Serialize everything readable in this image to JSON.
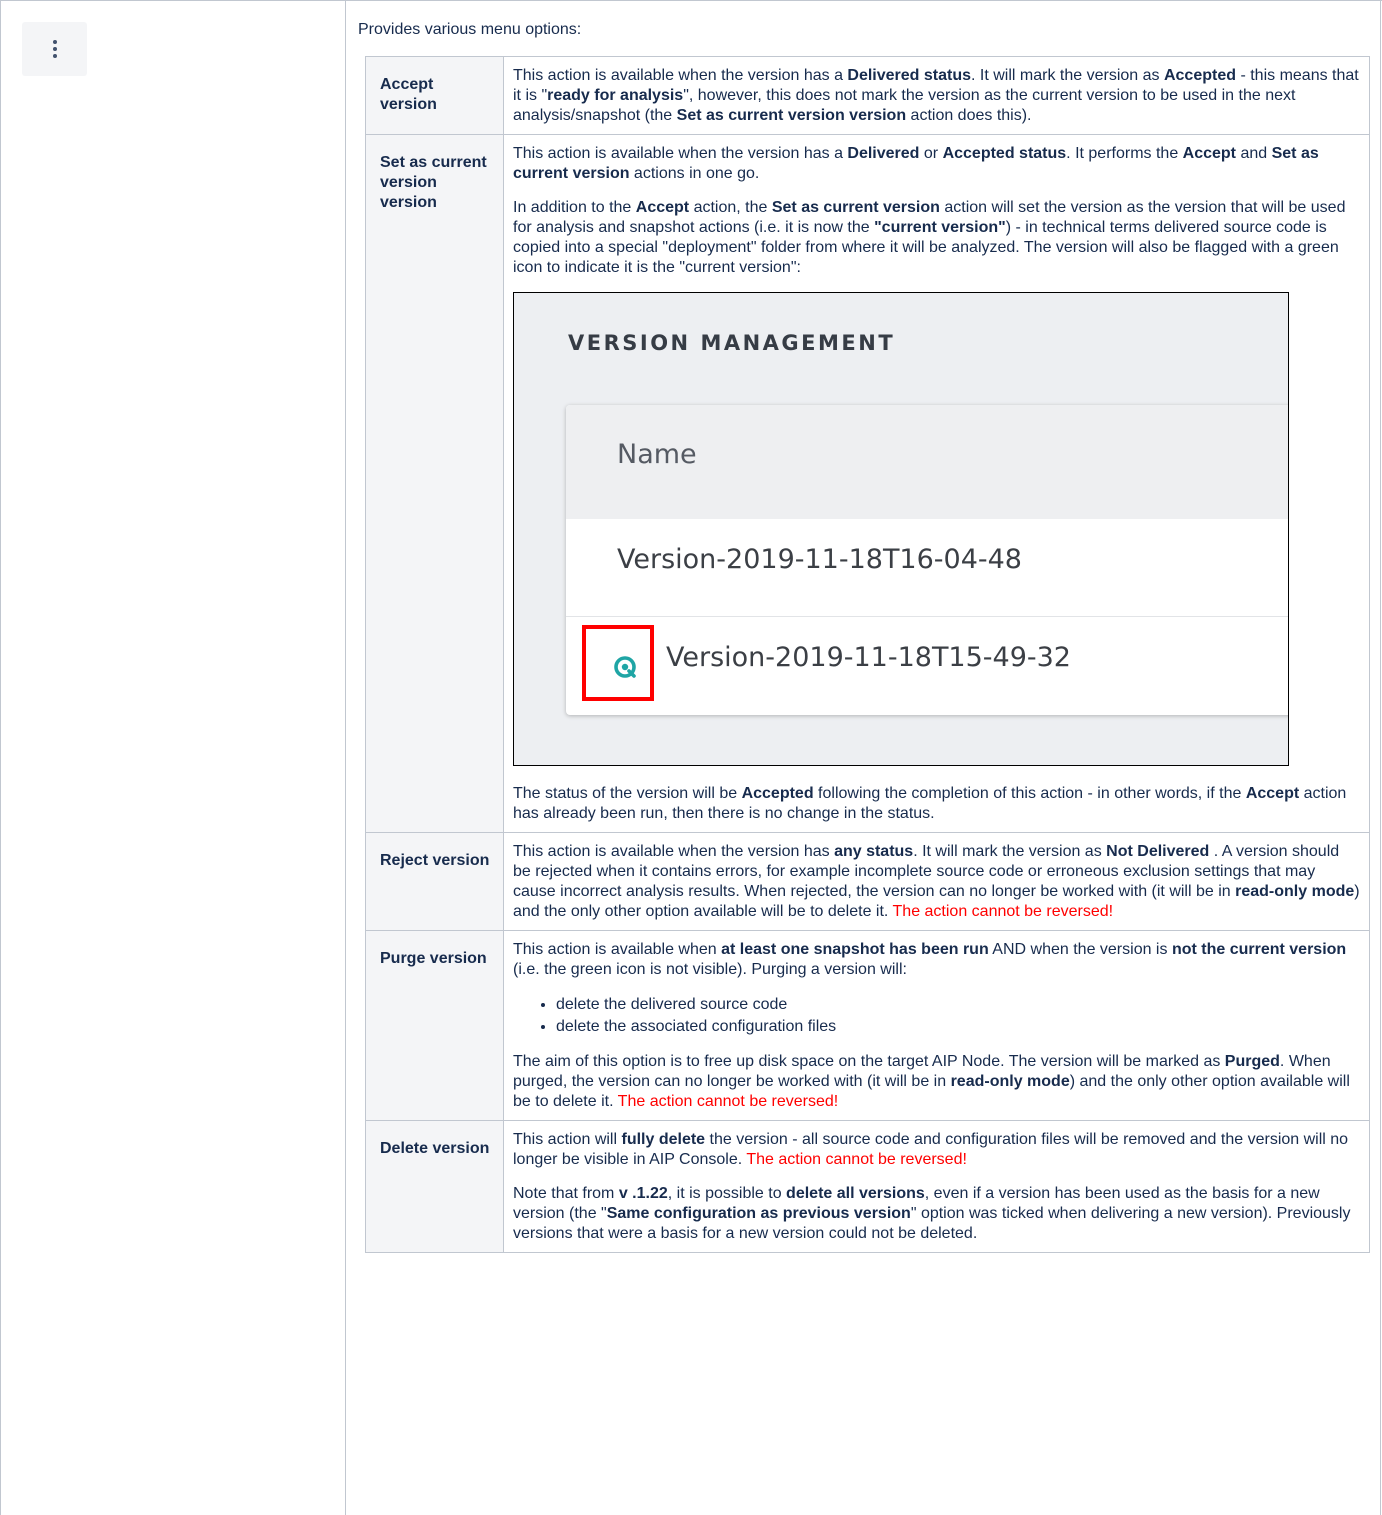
{
  "intro": "Provides various menu options:",
  "rows": {
    "accept": {
      "label": "Accept version",
      "p1": {
        "t1": "This action is available when the version has a ",
        "b1": "Delivered status",
        "t2": ". It will mark the version as ",
        "b2": "Accepted",
        "t3": " - this means that it is \"",
        "b3": "ready for analysis",
        "t4": "\", however, this does not mark the version as the current version to be used in the next analysis/snapshot (the ",
        "b4": "Set as current version version",
        "t5": " action does this)."
      }
    },
    "setcurrent": {
      "label": "Set as current version version",
      "p1": {
        "t1": "This action is available when the version has a ",
        "b1": "Delivered",
        "t2": " or ",
        "b2": "Accepted status",
        "t3": ". It performs the ",
        "b3": "Accept",
        "t4": " and ",
        "b4": "Set as current version",
        "t5": " actions in one go."
      },
      "p2": {
        "t1": "In addition to the ",
        "b1": "Accept",
        "t2": " action, the ",
        "b2": "Set as current version",
        "t3": " action will set the version as the version that will be used for analysis and snapshot actions (i.e. it is now the ",
        "b3": "\"current version\"",
        "t4": ") - in technical terms delivered source code is copied into a special \"deployment\" folder from where it will be analyzed. The version will also be flagged with a green icon to indicate it is the \"current version\":"
      },
      "screenshot": {
        "title": "VERSION MANAGEMENT",
        "column_header": "Name",
        "row1": "Version-2019-11-18T16-04-48",
        "row2": "Version-2019-11-18T15-49-32",
        "icon": "current-version-icon",
        "icon_color": "#1fa5a5",
        "highlight_color": "#ff0000"
      },
      "p3": {
        "t1": "The status of the version will be ",
        "b1": "Accepted",
        "t2": " following the completion of this action - in other words, if the ",
        "b2": "Accept",
        "t3": " action has already been run, then there is no change in the status."
      }
    },
    "reject": {
      "label": "Reject version",
      "p1": {
        "t1": "This action is available when the version has ",
        "b1": "any status",
        "t2": ". It will mark the version as ",
        "b2": "Not Delivered",
        "t3": " . A version should be rejected when it contains errors, for example incomplete source code or erroneous exclusion settings that may cause incorrect analysis results. When rejected, the version can no longer be worked with (it will be in ",
        "b3": "read-only mode",
        "t4": ") and the only other option available will be to delete it. ",
        "red": "The action cannot be reversed!"
      }
    },
    "purge": {
      "label": "Purge version",
      "p1": {
        "t1": "This action is available when ",
        "b1": "at least one snapshot has been run",
        "t2": " AND when the version is ",
        "b2": "not the current version",
        "t3": " (i.e. the green icon is not visible). Purging a version will:"
      },
      "bullets": [
        "delete the delivered source code",
        "delete the associated configuration files"
      ],
      "p2": {
        "t1": "The aim of this option is to free up disk space on the target AIP Node. The version will be marked as ",
        "b1": "Purged",
        "t2": ". When purged, the version can no longer be worked with (it will be in ",
        "b2": "read-only mode",
        "t3": ") and the only other option available will be to delete it. ",
        "red": "The action cannot be reversed!"
      }
    },
    "delete": {
      "label": "Delete version",
      "p1": {
        "t1": "This action will ",
        "b1": "fully delete",
        "t2": " the version - all source code and configuration files will be removed and the version will no longer be visible in AIP Console. ",
        "red": "The action cannot be reversed!"
      },
      "p2": {
        "t1": "Note that from ",
        "b1": "v .1.22",
        "t2": ", it is possible to ",
        "b2": "delete all versions",
        "t3": ", even if a version has been used as the basis for a new version (the \"",
        "b3": "Same configuration as previous version",
        "t4": "\" option was ticked when delivering a new version). Previously versions that were a basis for a new version could not be deleted."
      }
    }
  },
  "icons": {
    "menu": "vertical-ellipsis-icon"
  },
  "colors": {
    "red_text": "#ff0000",
    "header_bg": "#f4f5f7",
    "border": "#c1c7d0"
  }
}
